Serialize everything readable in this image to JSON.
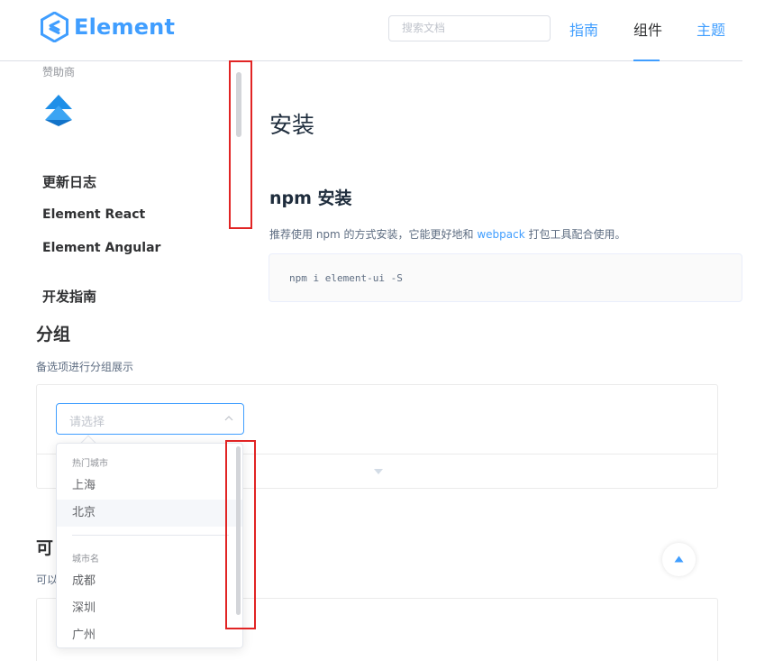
{
  "header": {
    "logo_text": "Element",
    "search_placeholder": "搜索文档",
    "nav": {
      "guide": "指南",
      "component": "组件",
      "theme": "主题"
    },
    "active_nav": "组件"
  },
  "sidebar": {
    "sponsor_label": "赞助商",
    "items": [
      {
        "label": "更新日志"
      },
      {
        "label": "Element React"
      },
      {
        "label": "Element Angular"
      },
      {
        "label": "开发指南"
      }
    ]
  },
  "install": {
    "title": "安装",
    "npm_title": "npm 安装",
    "npm_desc_before": "推荐使用 npm 的方式安装，它能更好地和 ",
    "npm_desc_link": "webpack",
    "npm_desc_after": " 打包工具配合使用。",
    "code": "npm i element-ui -S"
  },
  "group_demo": {
    "title": "分组",
    "desc": "备选项进行分组展示",
    "select_placeholder": "请选择",
    "groups": [
      {
        "title": "热门城市",
        "options": [
          "上海",
          "北京"
        ]
      },
      {
        "title": "城市名",
        "options": [
          "成都",
          "深圳",
          "广州"
        ]
      }
    ],
    "hovered_option": "北京"
  },
  "next_section": {
    "title_partial": "可",
    "desc_partial": "可以"
  },
  "colors": {
    "primary": "#409eff",
    "highlight_box": "#e12424"
  }
}
